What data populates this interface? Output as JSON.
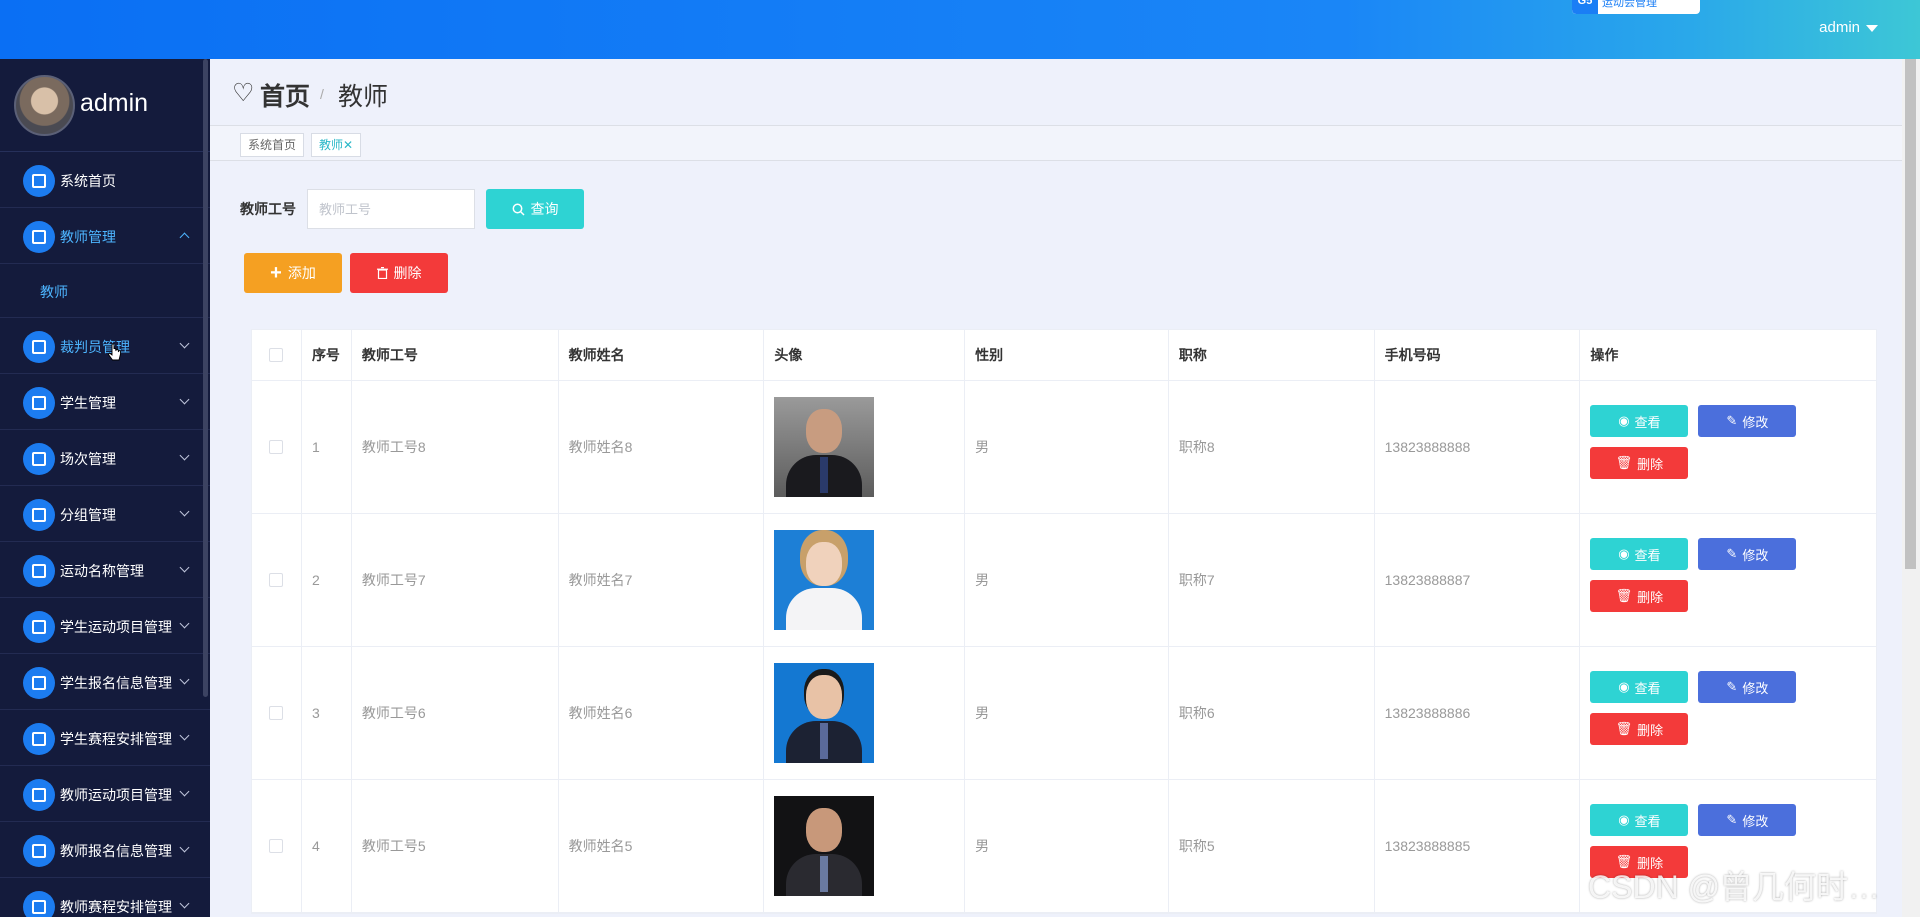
{
  "topbar": {
    "badge_icon": "G5",
    "badge_text": "运动会管理",
    "user": "admin"
  },
  "sidebar": {
    "profile_name": "admin",
    "items": [
      {
        "label": "系统首页",
        "icon": "home-icon"
      },
      {
        "label": "教师管理",
        "icon": "briefcase-icon",
        "active": true,
        "expanded": true
      },
      {
        "label": "教师",
        "sub": true
      },
      {
        "label": "裁判员管理",
        "icon": "sliders-icon",
        "active": true
      },
      {
        "label": "学生管理",
        "icon": "thumb-up-icon"
      },
      {
        "label": "场次管理",
        "icon": "monitor-icon"
      },
      {
        "label": "分组管理",
        "icon": "grid-icon"
      },
      {
        "label": "运动名称管理",
        "icon": "list-icon"
      },
      {
        "label": "学生运动项目管理",
        "icon": "grid-icon"
      },
      {
        "label": "学生报名信息管理",
        "icon": "grid-icon"
      },
      {
        "label": "学生赛程安排管理",
        "icon": "grid-icon"
      },
      {
        "label": "教师运动项目管理",
        "icon": "clipboard-icon"
      },
      {
        "label": "教师报名信息管理",
        "icon": "book-icon"
      },
      {
        "label": "教师赛程安排管理",
        "icon": "ticket-icon"
      }
    ]
  },
  "header": {
    "home": "首页",
    "separator": "/",
    "current": "教师"
  },
  "tabs": [
    {
      "label": "系统首页"
    },
    {
      "label": "教师"
    }
  ],
  "search": {
    "label": "教师工号",
    "placeholder": "教师工号",
    "button": "查询"
  },
  "actions": {
    "add": "添加",
    "delete": "删除"
  },
  "table": {
    "columns": [
      "序号",
      "教师工号",
      "教师姓名",
      "头像",
      "性别",
      "职称",
      "手机号码",
      "操作"
    ],
    "rows": [
      {
        "index": "1",
        "id": "教师工号8",
        "name": "教师姓名8",
        "gender": "男",
        "title": "职称8",
        "phone": "13823888888"
      },
      {
        "index": "2",
        "id": "教师工号7",
        "name": "教师姓名7",
        "gender": "男",
        "title": "职称7",
        "phone": "13823888887"
      },
      {
        "index": "3",
        "id": "教师工号6",
        "name": "教师姓名6",
        "gender": "男",
        "title": "职称6",
        "phone": "13823888886"
      },
      {
        "index": "4",
        "id": "教师工号5",
        "name": "教师姓名5",
        "gender": "男",
        "title": "职称5",
        "phone": "13823888885"
      }
    ],
    "row_actions": {
      "view": "查看",
      "edit": "修改",
      "delete": "删除"
    }
  },
  "watermark": "CSDN @曾几何时…",
  "colors": {
    "topbar": "#0a6ff4",
    "sidebar": "#141b3c",
    "accent_cyan": "#2ed3d3",
    "add_orange": "#f5a022",
    "delete_red": "#f33a3a",
    "edit_blue": "#4b6fdc"
  }
}
